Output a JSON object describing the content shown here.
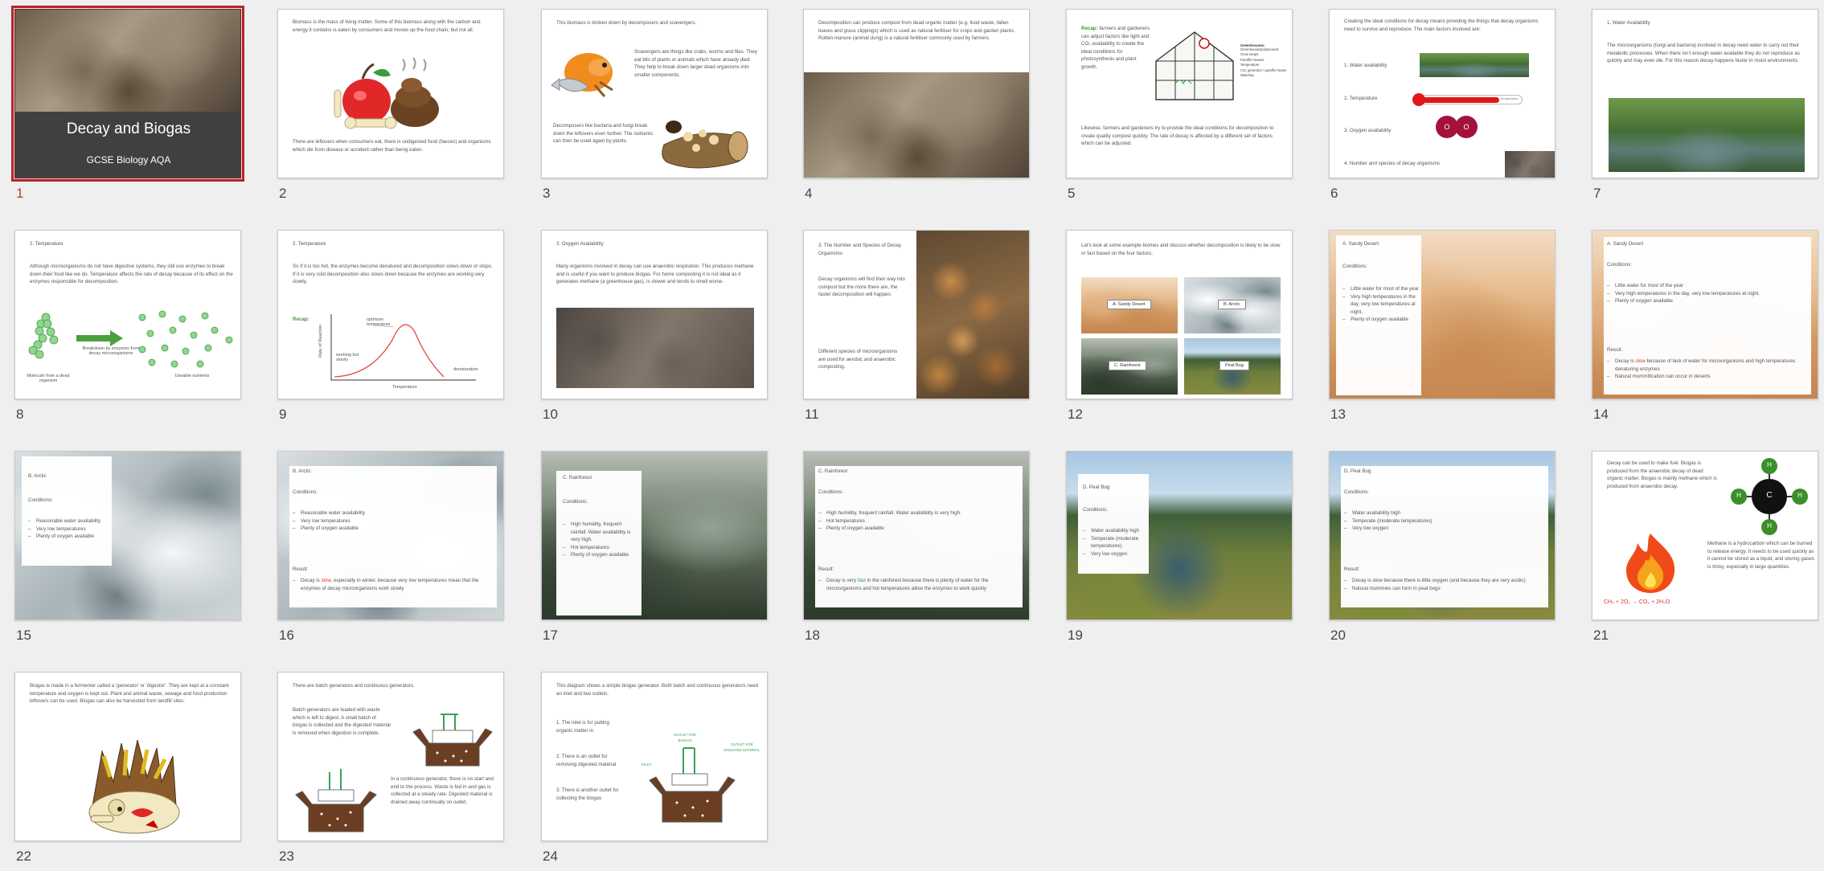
{
  "slides": [
    {
      "num": "1",
      "title": "Decay and Biogas",
      "subtitle": "GCSE Biology AQA"
    },
    {
      "num": "2",
      "text1": "Biomass is the mass of living matter. Some of this biomass along with the carbon and energy it contains is eaten by consumers and moves up the food chain; but not all.",
      "text2": "There are leftovers when consumers eat, there is undigested food (faeces) and organisms which die from disease or accident rather than being eaten."
    },
    {
      "num": "3",
      "text1": "This biomass is broken down by decomposers and scavengers.",
      "text2": "Scavengers are things like crabs, worms and flies. They eat bits of plants or animals which have already died. They help to break down larger dead organisms into smaller components.",
      "text3": "Decomposers like bacteria and fungi break down the leftovers even further. The nutrients can then be used again by plants."
    },
    {
      "num": "4",
      "text1": "Decomposition can produce compost from dead organic matter (e.g. food waste, fallen leaves and grass clippings) which is used as natural fertiliser for crops and garden plants. Rotten manure (animal dung) is a natural fertiliser commonly used by farmers."
    },
    {
      "num": "5",
      "recap": "Recap:",
      "text1": " farmers and gardeners can adjust factors like light and CO₂ availability to create the ideal conditions for photosynthesis and plant growth.",
      "list_title": "Greenhouses:",
      "list": [
        "Greenhouses/polytunnels",
        "Grow lamps",
        "Paraffin heaters",
        "Temperature",
        "CO₂ generator / paraffin heater",
        "Watering"
      ],
      "text2": "Likewise, farmers and gardeners try to provide the ideal conditions for decomposition to create quality compost quickly. The rate of decay is affected by a different set of factors which can be adjusted."
    },
    {
      "num": "6",
      "text1": "Creating the ideal conditions for decay means providing the things that decay organisms need to survive and reproduce. The main factors involved are:",
      "items": [
        "1.  Water availability",
        "2.  Temperature",
        "3.  Oxygen availability",
        "4.  Number and species of decay organisms"
      ],
      "o_label": "O",
      "thermo_label": "temperature"
    },
    {
      "num": "7",
      "title": "1.  Water Availability",
      "text1": "The microorganisms (fungi and bacteria) involved in decay need water to carry out their metabolic processes. When there isn't enough water available they do not reproduce as quickly and may even die. For this reason decay happens faster in moist environments."
    },
    {
      "num": "8",
      "title": "2. Temperature",
      "text1": "Although microorganisms do not have digestive systems, they still use enzymes to break down their food like we do. Temperature affects the rate of decay because of its effect on the enzymes responsible for decomposition.",
      "lbl_molecule": "Molecule from a dead organism",
      "lbl_breakdown": "Breakdown by enzymes from decay microorganisms",
      "lbl_simple": "Useable nutrients"
    },
    {
      "num": "9",
      "title": "2. Temperature",
      "text1": "So if it is too hot, the enzymes become denatured and decomposition slows down or stops. If it is very cold decomposition also slows down because the enzymes are working very slowly.",
      "recap": "Recap:",
      "lbl_optimum": "optimum temperature",
      "lbl_working": "working but slowly",
      "lbl_denat": "denaturation",
      "ylabel": "Rate of Reaction",
      "xlabel": "Temperature"
    },
    {
      "num": "10",
      "title": "3. Oxygen Availability",
      "text1": "Many organisms involved in decay can use anaerobic respiration. This produces methane and is useful if you want to produce biogas. For home composting it is not ideal as it generates methane (a greenhouse gas), is slower and tends to smell worse."
    },
    {
      "num": "11",
      "title": "3. The Number and Species of Decay Organisms",
      "text1": "Decay organisms will find their way into compost but the more there are, the faster decomposition will happen.",
      "text2": "Different species of microorganisms are used for aerobic and anaerobic composting."
    },
    {
      "num": "12",
      "text1": "Let's look at some example biomes and discuss whether decomposition is likely to be slow or fast based on the four factors.",
      "labels": [
        "A. Sandy Desert",
        "B. Arctic",
        "C. Rainforest",
        "Peat Bog"
      ]
    },
    {
      "num": "13",
      "title": "A. Sandy Desert",
      "conditions": "Conditions:",
      "list": [
        "Little water for most of the year",
        "Very high temperatures in the day, very low temperatures at night.",
        "Plenty of oxygen available"
      ]
    },
    {
      "num": "14",
      "title": "A. Sandy Desert",
      "conditions": "Conditions:",
      "list": [
        "Little water for most of the year",
        "Very high temperatures in the day, very low temperatures at night.",
        "Plenty of oxygen available"
      ],
      "result": "Result:",
      "r1a": "Decay is ",
      "r1b": "slow",
      "r1c": " because of lack of water for microorganisms and high temperatures denaturing enzymes",
      "r2": "Natural mummification can occur in deserts"
    },
    {
      "num": "15",
      "title": "B. Arctic",
      "conditions": "Conditions:",
      "list": [
        "Reasonable water availability",
        "Very low temperatures",
        "Plenty of oxygen available"
      ]
    },
    {
      "num": "16",
      "title": "B. Arctic",
      "conditions": "Conditions:",
      "list": [
        "Reasonable water availability",
        "Very low temperatures",
        "Plenty of oxygen available"
      ],
      "result": "Result:",
      "r1a": "Decay is ",
      "r1b": "slow",
      "r1c": ", especially in winter, because very low temperatures mean that the enzymes of decay microorganisms work slowly"
    },
    {
      "num": "17",
      "title": "C. Rainforest",
      "conditions": "Conditions:",
      "list": [
        "High humidity, frequent rainfall. Water availability is very high.",
        "Hot temperatures",
        "Plenty of oxygen available"
      ]
    },
    {
      "num": "18",
      "title": "C. Rainforest",
      "conditions": "Conditions:",
      "list": [
        "High humidity, frequent rainfall. Water availability is very high.",
        "Hot temperatures",
        "Plenty of oxygen available"
      ],
      "result": "Result:",
      "r1a": "Decay is very ",
      "r1b": "fast",
      "r1c": " in the rainforest because there is plenty of water for the microorganisms and hot temperatures allow the enzymes to work quickly"
    },
    {
      "num": "19",
      "title": "D. Peat Bog",
      "conditions": "Conditions:",
      "list": [
        "Water availability high",
        "Temperate (moderate temperatures)",
        "Very low oxygen"
      ]
    },
    {
      "num": "20",
      "title": "D. Peat Bog",
      "conditions": "Conditions:",
      "list": [
        "Water availability high",
        "Temperate (moderate temperatures)",
        "Very low oxygen"
      ],
      "result": "Result:",
      "r1": "Decay is slow because there is little oxygen (and because they are very acidic)",
      "r2": "Natural mummies can form in peat bogs"
    },
    {
      "num": "21",
      "text1": "Decay can be used to make fuel. Biogas is produced from the anaerobic decay of dead organic matter. Biogas is mainly methane which is produced from anaerobic decay.",
      "text2": "Methane is a hydrocarbon which can be burned to release energy. It needs to be used quickly as it cannot be stored as a liquid, and storing gases is tricky, especially in large quantities.",
      "eq1": "CH₄ + 2O₂",
      "eq2": " → CO₂ + 2H₂O",
      "atom_c": "C",
      "atom_h": "H"
    },
    {
      "num": "22",
      "text1": "Biogas is made in a fermenter called a 'generator' or 'digestor'. They are kept at a constant temperature and oxygen is kept out. Plant and animal waste, sewage and food production leftovers can be used. Biogas can also be harvested from landfill sites."
    },
    {
      "num": "23",
      "text1": "There are batch generators and continuous generators.",
      "text2": "Batch generators are loaded with waste which is left to digest. A small batch of biogas is collected and the digested material is removed when digestion is complete.",
      "text3": "In a continuous generator, there is no start and end to the process. Waste is fed in and gas is collected at a steady rate. Digested material is drained away continually on outlet."
    },
    {
      "num": "24",
      "text1": "This diagram shows a simple biogas generator. Both batch and continuous generators need an inlet and two outlets.",
      "items": [
        "1.  The inlet is for putting organic matter in",
        "2.  There is an outlet for removing digested material",
        "3.  There is another outlet for collecting the biogas"
      ],
      "lbl_biogas": "OUTLET FOR BIOGAS",
      "lbl_digested": "OUTLET FOR DIGESTED MATERIAL",
      "lbl_inlet": "INLET"
    }
  ]
}
